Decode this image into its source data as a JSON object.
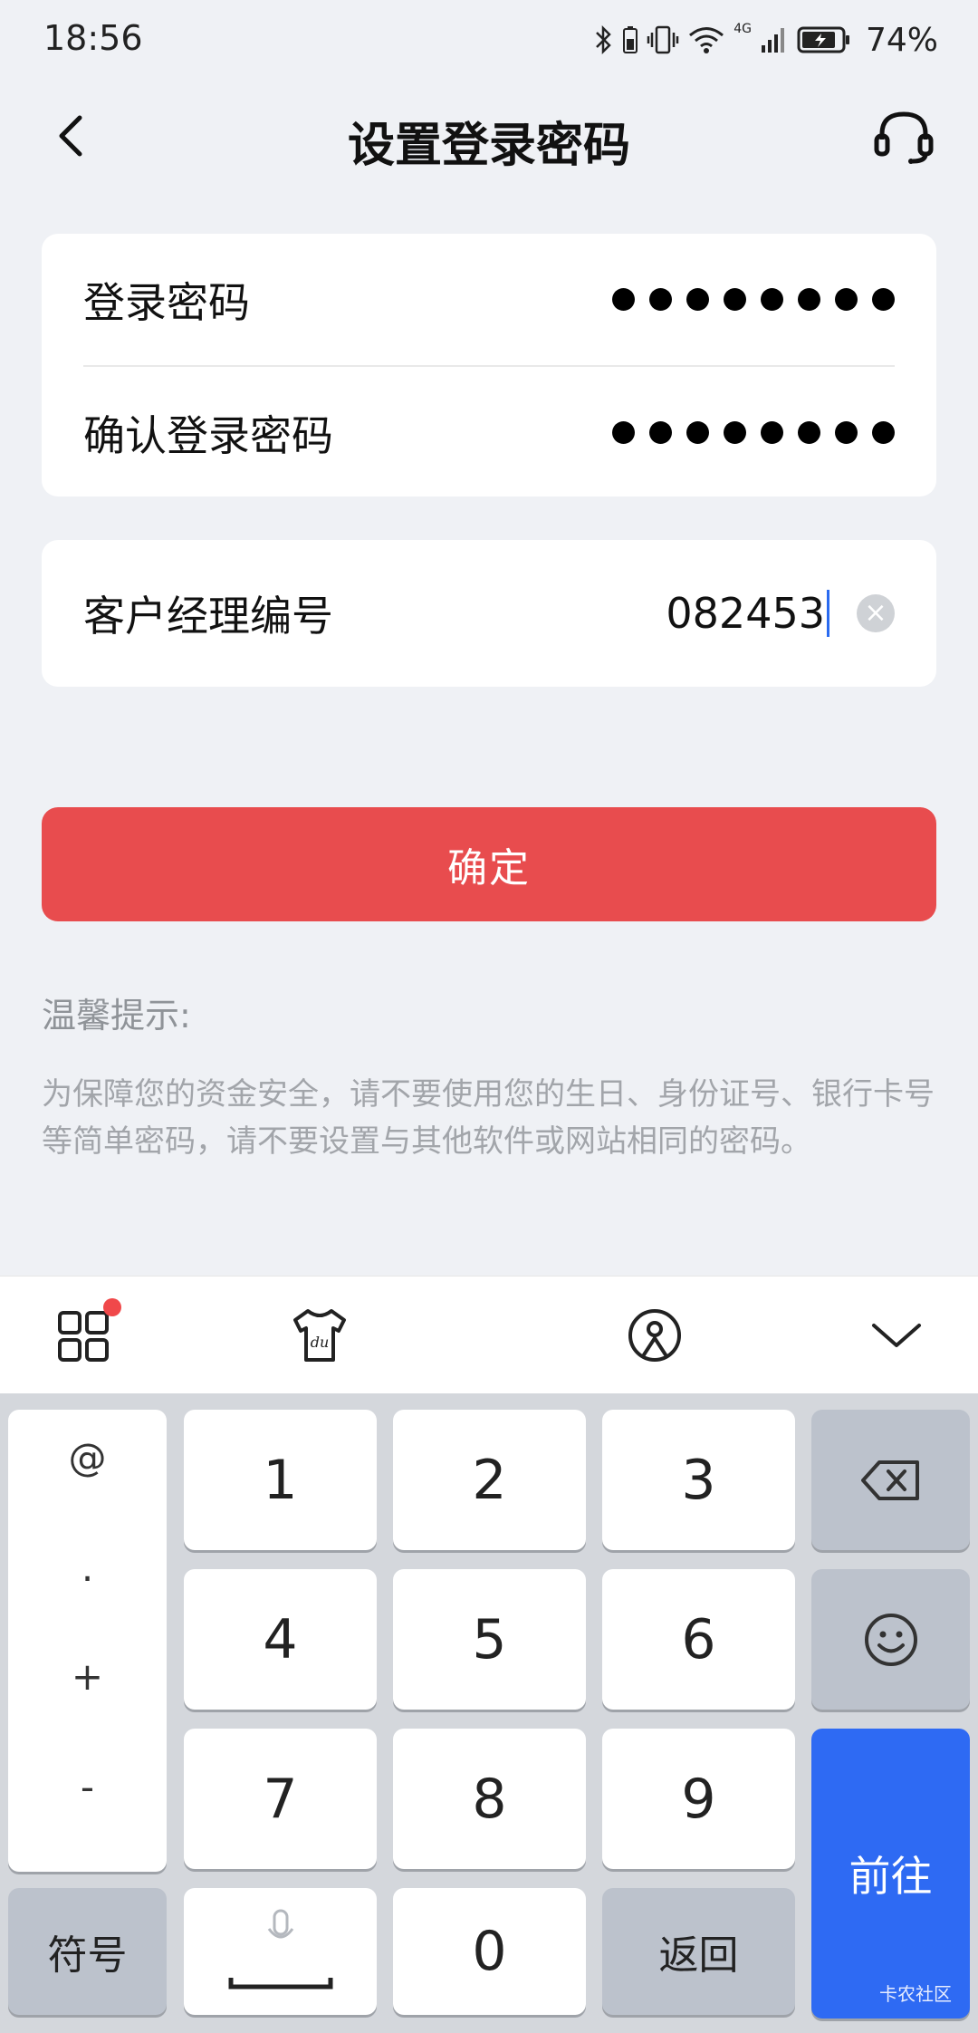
{
  "status": {
    "time": "18:56",
    "network": "4G",
    "battery": "74%"
  },
  "nav": {
    "title": "设置登录密码"
  },
  "form": {
    "password_label": "登录密码",
    "confirm_label": "确认登录密码",
    "masked_length": 8,
    "manager_label": "客户经理编号",
    "manager_value": "082453"
  },
  "confirm_label": "确定",
  "tips": {
    "title": "温馨提示:",
    "body": "为保障您的资金安全，请不要使用您的生日、身份证号、银行卡号等简单密码，请不要设置与其他软件或网站相同的密码。"
  },
  "keyboard": {
    "side": [
      "@",
      ".",
      "+",
      "-"
    ],
    "digits": [
      "1",
      "2",
      "3",
      "4",
      "5",
      "6",
      "7",
      "8",
      "9",
      "0"
    ],
    "symbol_label": "符号",
    "return_label": "返回",
    "go_label": "前往",
    "watermark": "卡农社区"
  },
  "colors": {
    "confirm": "#e84c4e",
    "go": "#2e6af3",
    "caret": "#2a6bf0"
  }
}
